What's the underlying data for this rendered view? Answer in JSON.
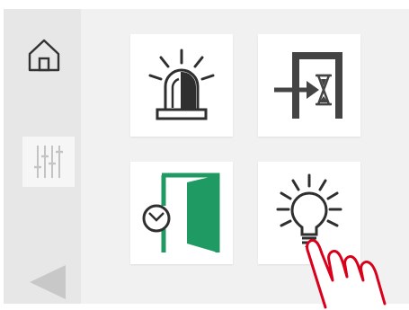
{
  "sidebar": {
    "items": [
      {
        "name": "home",
        "icon": "home-icon"
      },
      {
        "name": "settings",
        "icon": "sliders-icon",
        "selected": true
      },
      {
        "name": "back",
        "icon": "back-arrow-icon"
      }
    ]
  },
  "tiles": [
    {
      "name": "alarm",
      "icon": "siren-icon"
    },
    {
      "name": "delayed-exit",
      "icon": "door-hourglass-icon"
    },
    {
      "name": "door-timer",
      "icon": "clock-door-icon"
    },
    {
      "name": "light",
      "icon": "lightbulb-icon"
    }
  ],
  "colors": {
    "panel": "#f1f1f1",
    "sidebar": "#e7e7e7",
    "icon_stroke": "#2f2f2f",
    "door_green": "#1f9a63",
    "hand_red": "#d9001b",
    "back_arrow": "#c8c8c8"
  }
}
